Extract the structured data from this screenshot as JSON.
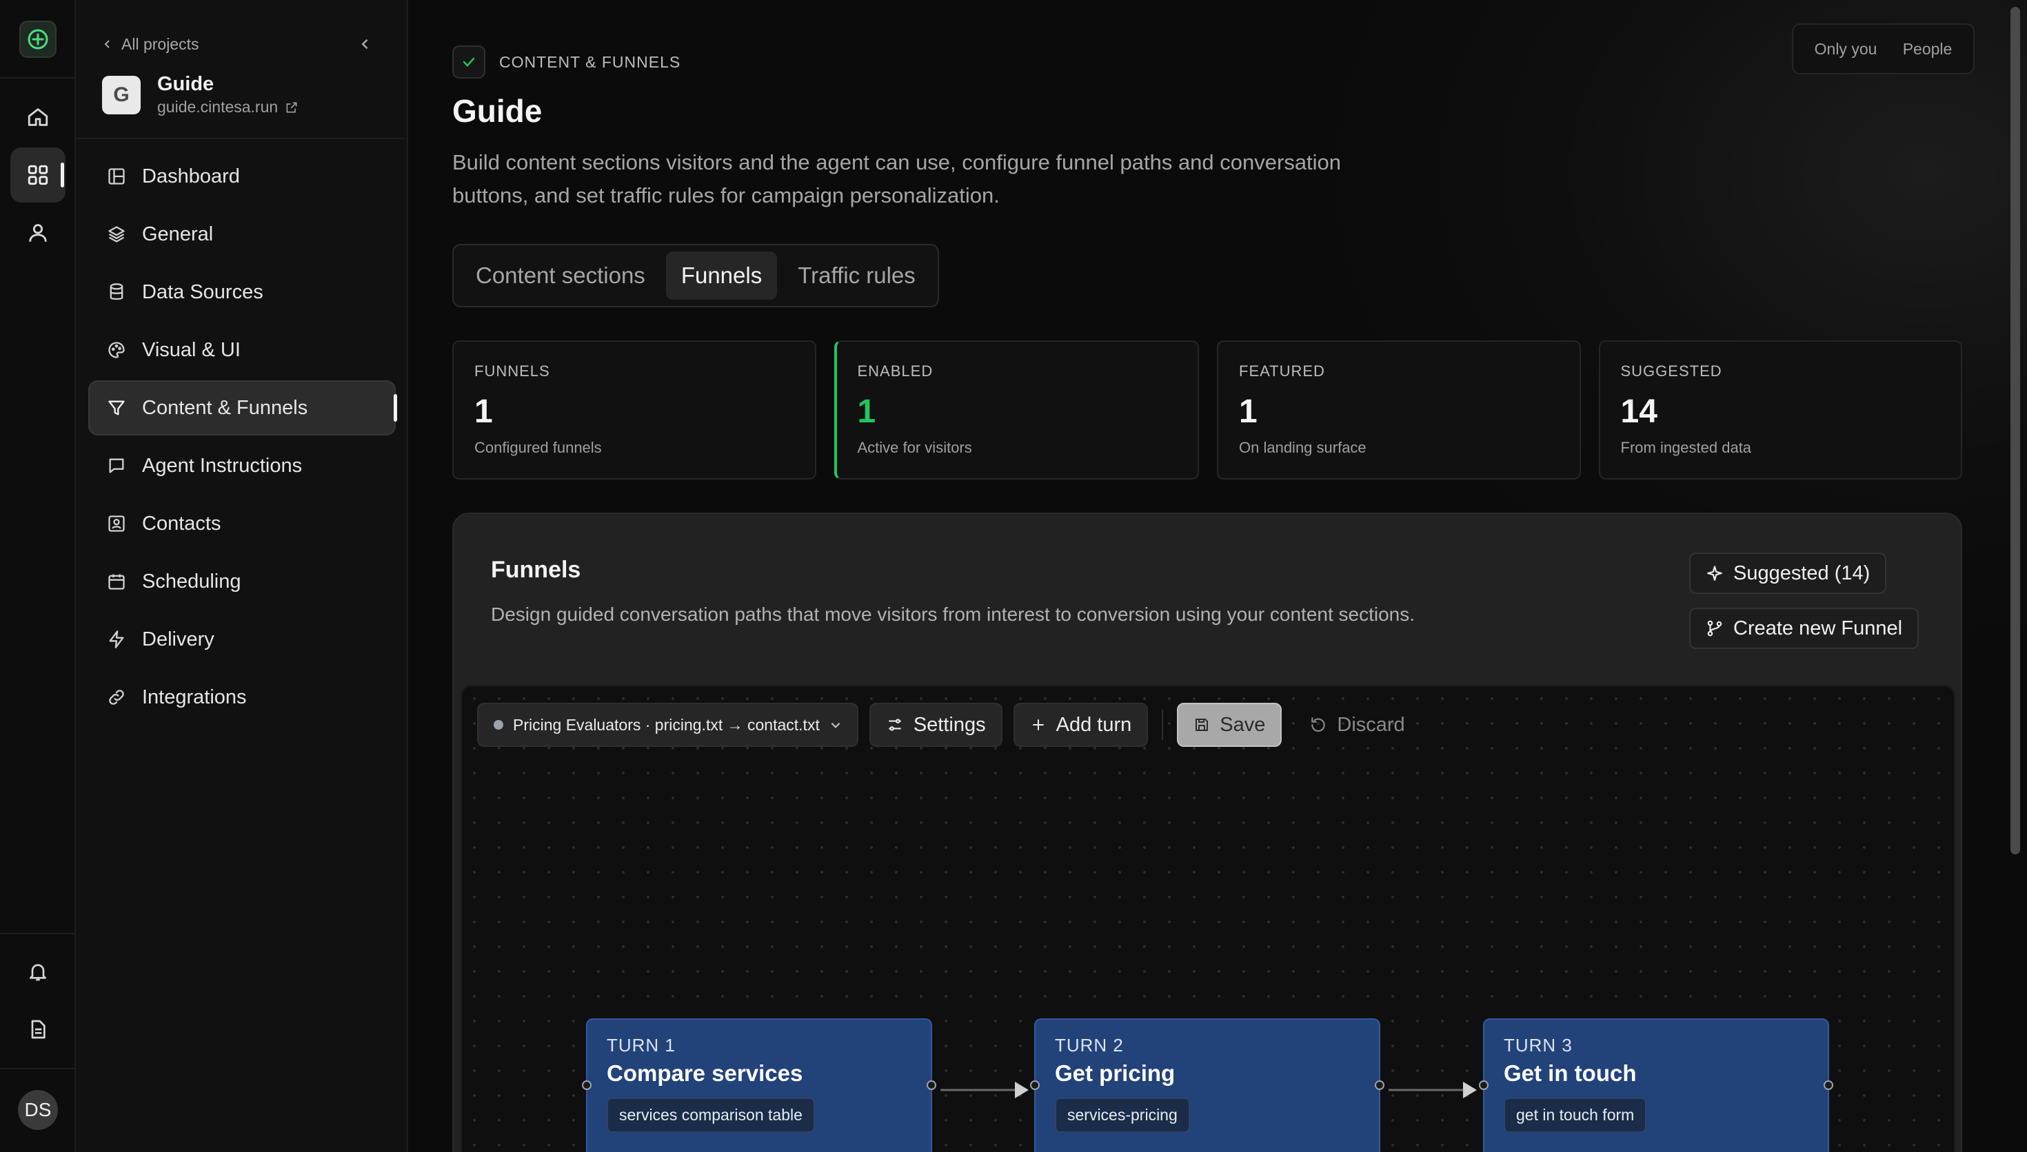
{
  "rail": {
    "avatar_initials": "DS"
  },
  "sidebar": {
    "back_label": "All projects",
    "project": {
      "name": "Guide",
      "url": "guide.cintesa.run",
      "logo_letter": "G"
    },
    "items": [
      {
        "label": "Dashboard",
        "icon": "dashboard-icon"
      },
      {
        "label": "General",
        "icon": "layers-icon"
      },
      {
        "label": "Data Sources",
        "icon": "database-icon"
      },
      {
        "label": "Visual & UI",
        "icon": "palette-icon"
      },
      {
        "label": "Content & Funnels",
        "icon": "filter-icon",
        "active": true
      },
      {
        "label": "Agent Instructions",
        "icon": "chat-icon"
      },
      {
        "label": "Contacts",
        "icon": "contact-card-icon"
      },
      {
        "label": "Scheduling",
        "icon": "calendar-icon"
      },
      {
        "label": "Delivery",
        "icon": "lightning-icon"
      },
      {
        "label": "Integrations",
        "icon": "link-icon"
      }
    ]
  },
  "view_toggle": {
    "option_1": "Only you",
    "option_2": "People"
  },
  "header": {
    "crumb": "CONTENT & FUNNELS",
    "title": "Guide",
    "description": "Build content sections visitors and the agent can use, configure funnel paths and conversation buttons, and set traffic rules for campaign personalization."
  },
  "tabs": [
    {
      "label": "Content sections"
    },
    {
      "label": "Funnels",
      "active": true
    },
    {
      "label": "Traffic rules"
    }
  ],
  "stats": [
    {
      "label": "FUNNELS",
      "value": "1",
      "sub": "Configured funnels"
    },
    {
      "label": "ENABLED",
      "value": "1",
      "sub": "Active for visitors"
    },
    {
      "label": "FEATURED",
      "value": "1",
      "sub": "On landing surface"
    },
    {
      "label": "SUGGESTED",
      "value": "14",
      "sub": "From ingested data"
    }
  ],
  "panel": {
    "title": "Funnels",
    "description": "Design guided conversation paths that move visitors from interest to conversion using your content sections.",
    "suggested_label": "Suggested (14)",
    "create_label": "Create new Funnel"
  },
  "toolbar": {
    "funnel_select": "Pricing Evaluators · pricing.txt → contact.txt",
    "settings_label": "Settings",
    "add_turn_label": "Add turn",
    "save_label": "Save",
    "discard_label": "Discard"
  },
  "turns": [
    {
      "turn": "TURN 1",
      "title": "Compare services",
      "chip": "services comparison table"
    },
    {
      "turn": "TURN 2",
      "title": "Get pricing",
      "chip": "services-pricing"
    },
    {
      "turn": "TURN 3",
      "title": "Get in touch",
      "chip": "get in touch form"
    }
  ],
  "colors": {
    "accent_green": "#22c55e",
    "node_blue": "#22427a"
  }
}
